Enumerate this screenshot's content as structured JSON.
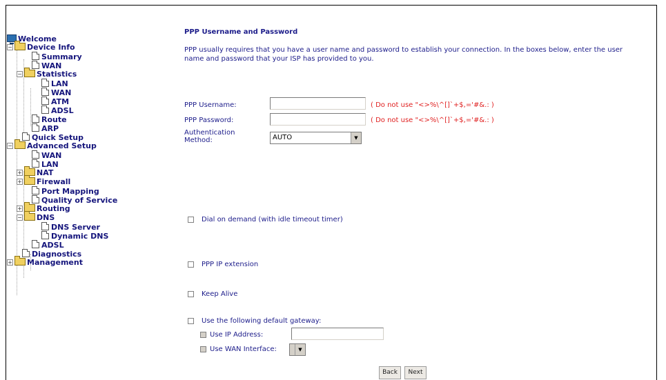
{
  "sidebar": {
    "welcome": "Welcome",
    "device_info": "Device Info",
    "summary": "Summary",
    "wan": "WAN",
    "statistics": "Statistics",
    "stat_lan": "LAN",
    "stat_wan": "WAN",
    "stat_atm": "ATM",
    "stat_adsl": "ADSL",
    "route": "Route",
    "arp": "ARP",
    "quick_setup": "Quick Setup",
    "advanced_setup": "Advanced Setup",
    "adv_wan": "WAN",
    "adv_lan": "LAN",
    "nat": "NAT",
    "firewall": "Firewall",
    "port_mapping": "Port Mapping",
    "qos": "Quality of Service",
    "routing": "Routing",
    "dns": "DNS",
    "dns_server": "DNS Server",
    "dynamic_dns": "Dynamic DNS",
    "adsl": "ADSL",
    "diagnostics": "Diagnostics",
    "management": "Management"
  },
  "main": {
    "title": "PPP Username and Password",
    "description": "PPP usually requires that you have a user name and password to establish your connection. In the boxes below, enter the user name and password that your ISP has provided to you.",
    "username_label": "PPP Username:",
    "username_value": "",
    "username_hint": "( Do not use \"<>%\\^[]`+$,='#&.: )",
    "password_label": "PPP Password:",
    "password_value": "",
    "password_hint": "( Do not use \"<>%\\^[]`+$,='#&.: )",
    "auth_label": "Authentication Method:",
    "auth_value": "AUTO",
    "dial_on_demand": "Dial on demand (with idle timeout timer)",
    "ppp_ip_extension": "PPP IP extension",
    "keep_alive": "Keep Alive",
    "use_default_gateway": "Use the following default gateway:",
    "use_ip_address": "Use IP Address:",
    "ip_address_value": "",
    "use_wan_interface": "Use WAN Interface:",
    "wan_interface_value": "",
    "back_button": "Back",
    "next_button": "Next"
  }
}
